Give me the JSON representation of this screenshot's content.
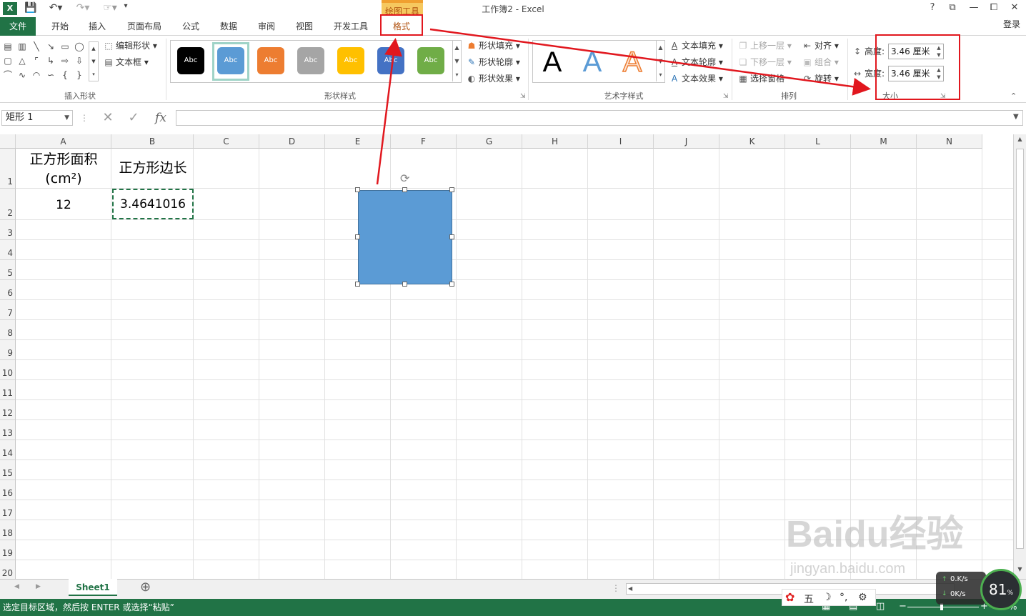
{
  "titlebar": {
    "context_tab": "绘图工具",
    "title": "工作簿2 - Excel",
    "buttons": [
      "?",
      "⧉",
      "—",
      "⧠",
      "✕"
    ]
  },
  "tabs": {
    "file": "文件",
    "items": [
      "开始",
      "插入",
      "页面布局",
      "公式",
      "数据",
      "审阅",
      "视图",
      "开发工具",
      "格式"
    ],
    "login": "登录"
  },
  "ribbon": {
    "insert_shapes": {
      "edit_shape": "编辑形状",
      "text_box": "文本框",
      "label": "插入形状"
    },
    "shape_styles": {
      "swatches": [
        {
          "text": "Abc",
          "color": "#000000"
        },
        {
          "text": "Abc",
          "color": "#5b9bd5"
        },
        {
          "text": "Abc",
          "color": "#ed7d31"
        },
        {
          "text": "Abc",
          "color": "#a5a5a5"
        },
        {
          "text": "Abc",
          "color": "#ffc000"
        },
        {
          "text": "Abc",
          "color": "#4472c4"
        },
        {
          "text": "Abc",
          "color": "#70ad47"
        }
      ],
      "fill": "形状填充",
      "outline": "形状轮廓",
      "effects": "形状效果",
      "label": "形状样式"
    },
    "wordart": {
      "letters": [
        "A",
        "A",
        "A"
      ],
      "text_fill": "文本填充",
      "text_outline": "文本轮廓",
      "text_effects": "文本效果",
      "label": "艺术字样式"
    },
    "arrange": {
      "bring_forward": "上移一层",
      "send_backward": "下移一层",
      "selection_pane": "选择窗格",
      "align": "对齐",
      "group": "组合",
      "rotate": "旋转",
      "label": "排列"
    },
    "size": {
      "height_label": "高度:",
      "height_value": "3.46 厘米",
      "width_label": "宽度:",
      "width_value": "3.46 厘米",
      "label": "大小"
    }
  },
  "formula_bar": {
    "name_box": "矩形 1",
    "fx": "fx",
    "value": ""
  },
  "columns": [
    "A",
    "B",
    "C",
    "D",
    "E",
    "F",
    "G",
    "H",
    "I",
    "J",
    "K",
    "L",
    "M",
    "N"
  ],
  "rows": [
    "1",
    "2",
    "3",
    "4",
    "5",
    "6",
    "7",
    "8",
    "9",
    "10",
    "11",
    "12",
    "13",
    "14",
    "15",
    "16",
    "17",
    "18",
    "19",
    "20"
  ],
  "cells": {
    "A1_line1": "正方形面积",
    "A1_line2": "(cm²)",
    "B1": "正方形边长",
    "A2": "12",
    "B2": "3.4641016"
  },
  "sheets": {
    "active": "Sheet1",
    "add": "⊕"
  },
  "status": {
    "message": "选定目标区域，然后按 ENTER 或选择“粘贴”",
    "zoom": "%"
  },
  "overlay": {
    "ime_items": [
      "五",
      "☽",
      "°,",
      "⚙"
    ],
    "net_up": "0.K/s",
    "net_down": "0K/s",
    "percent": "81",
    "percent_unit": "%"
  },
  "watermark": {
    "logo": "Baidu经验",
    "url": "jingyan.baidu.com"
  }
}
